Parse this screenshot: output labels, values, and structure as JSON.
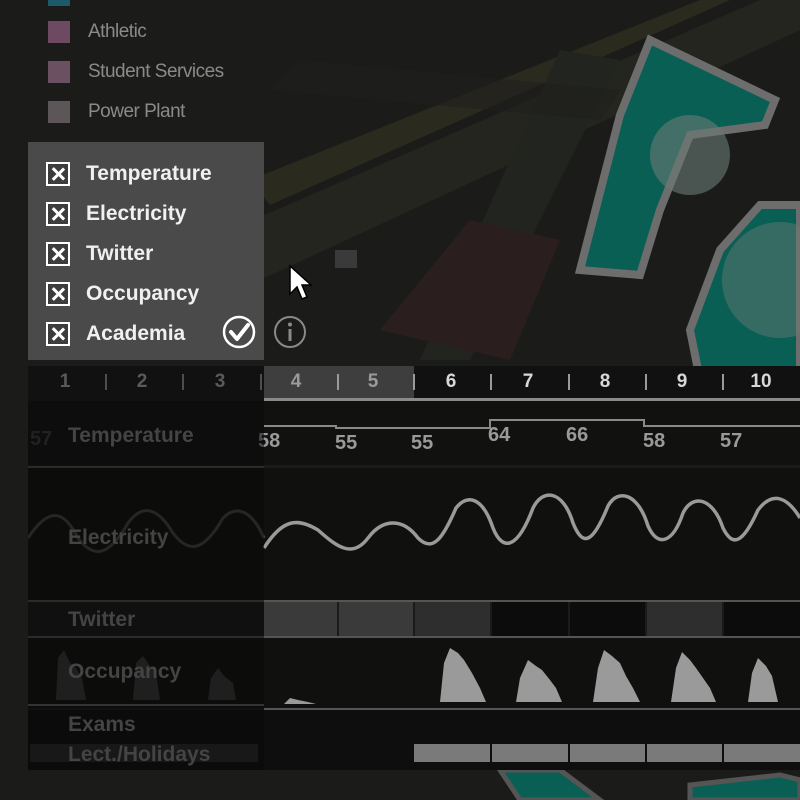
{
  "legend": [
    {
      "label": "Athletic",
      "color": "#6e4a62"
    },
    {
      "label": "Student Services",
      "color": "#6a5060"
    },
    {
      "label": "Power Plant",
      "color": "#5c5658"
    }
  ],
  "layers": [
    {
      "label": "Temperature",
      "checked": true
    },
    {
      "label": "Electricity",
      "checked": true
    },
    {
      "label": "Twitter",
      "checked": true
    },
    {
      "label": "Occupancy",
      "checked": true
    },
    {
      "label": "Academia",
      "checked": true
    }
  ],
  "weeks": [
    "1",
    "2",
    "3",
    "4",
    "5",
    "6",
    "7",
    "8",
    "9",
    "10"
  ],
  "rows": {
    "temperature": "Temperature",
    "electricity": "Electricity",
    "twitter": "Twitter",
    "occupancy": "Occupancy",
    "exams": "Exams",
    "lect_holidays": "Lect./Holidays"
  },
  "temperatures": [
    "57",
    "58",
    "55",
    "55",
    "64",
    "66",
    "58",
    "57"
  ],
  "colors": {
    "teal": "#0c6e62",
    "panel": "#4a4a4a",
    "track": "#111111"
  }
}
